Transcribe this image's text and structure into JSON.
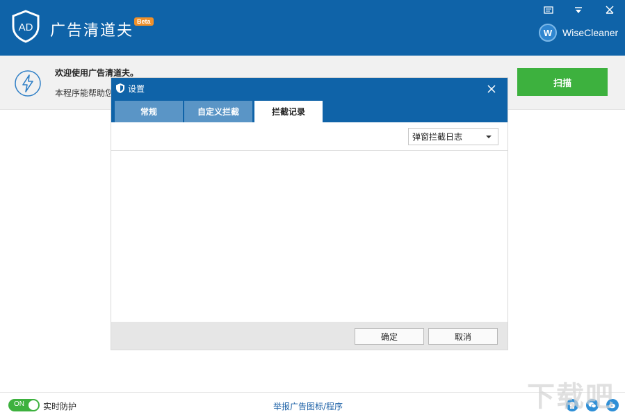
{
  "app": {
    "title": "广告清道夫",
    "badge": "Beta",
    "brand": "WiseCleaner",
    "brand_initial": "W"
  },
  "banner": {
    "welcome": "欢迎使用广告清道夫。",
    "description": "本程序能帮助您",
    "scan_label": "扫描"
  },
  "dialog": {
    "title": "设置",
    "tabs": [
      {
        "label": "常规"
      },
      {
        "label": "自定义拦截"
      },
      {
        "label": "拦截记录"
      }
    ],
    "active_tab": "拦截记录",
    "select_value": "弹窗拦截日志",
    "ok_label": "确定",
    "cancel_label": "取消"
  },
  "footer": {
    "toggle_label": "ON",
    "realtime_label": "实时防护",
    "report_link": "举报广告图标/程序"
  },
  "colors": {
    "primary": "#0f63a8",
    "tab_inactive": "#5a95c6",
    "accent_green": "#3db13e",
    "beta_orange": "#f0902a"
  }
}
